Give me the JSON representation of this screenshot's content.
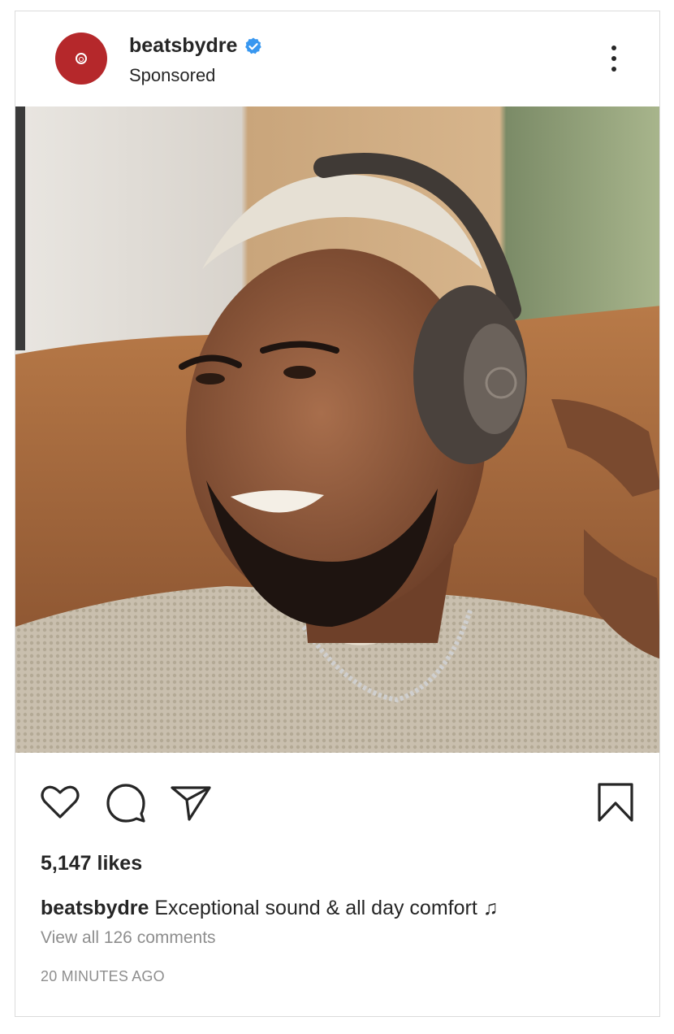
{
  "post": {
    "username": "beatsbydre",
    "subtitle": "Sponsored",
    "verified": true,
    "brand_color": "#b5282b",
    "verified_color": "#3897f0",
    "likes": "5,147 likes",
    "caption_user": "beatsbydre",
    "caption_text": "Exceptional sound & all day comfort",
    "caption_emoji": "♫",
    "comments_link": "View all 126 comments",
    "timestamp": "20 MINUTES AGO"
  },
  "icons": {
    "avatar": "beats-logo-icon",
    "verified": "verified-badge-icon",
    "more": "more-options-icon",
    "like": "heart-icon",
    "comment": "comment-bubble-icon",
    "share": "paper-plane-icon",
    "save": "bookmark-icon"
  }
}
